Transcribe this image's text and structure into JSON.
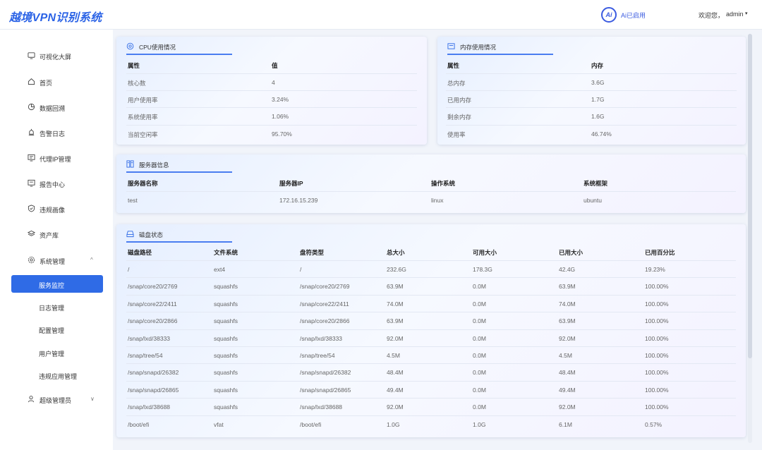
{
  "header": {
    "brand": "越境VPN识别系统",
    "ai_badge": "Ai",
    "ai_status": "Ai已启用",
    "welcome": "欢迎您，",
    "user": "admin",
    "caret": "▾"
  },
  "sidebar": {
    "items": [
      {
        "label": "可视化大屏",
        "icon": "monitor-icon"
      },
      {
        "label": "首页",
        "icon": "home-icon"
      },
      {
        "label": "数据回溯",
        "icon": "pie-chart-icon"
      },
      {
        "label": "告警日志",
        "icon": "alarm-icon"
      },
      {
        "label": "代理IP管理",
        "icon": "proxy-monitor-icon"
      },
      {
        "label": "报告中心",
        "icon": "report-icon"
      },
      {
        "label": "违规画像",
        "icon": "shield-icon"
      },
      {
        "label": "资产库",
        "icon": "layers-icon"
      },
      {
        "label": "系统管理",
        "icon": "settings-icon"
      }
    ],
    "system_arrow": "^",
    "sub_items": [
      {
        "label": "服务监控"
      },
      {
        "label": "日志管理"
      },
      {
        "label": "配置管理"
      },
      {
        "label": "用户管理"
      },
      {
        "label": "违规应用管理"
      }
    ],
    "super_admin": {
      "label": "超级管理员",
      "icon": "user-icon",
      "arrow": "∨"
    }
  },
  "cpu": {
    "title": "CPU使用情况",
    "icon": "cpu-icon",
    "headers": [
      "属性",
      "值"
    ],
    "rows": [
      [
        "核心数",
        "4"
      ],
      [
        "用户使用率",
        "3.24%"
      ],
      [
        "系统使用率",
        "1.06%"
      ],
      [
        "当前空闲率",
        "95.70%"
      ]
    ]
  },
  "memory": {
    "title": "内存使用情况",
    "icon": "memory-icon",
    "headers": [
      "属性",
      "内存"
    ],
    "rows": [
      [
        "总内存",
        "3.6G"
      ],
      [
        "已用内存",
        "1.7G"
      ],
      [
        "剩余内存",
        "1.6G"
      ],
      [
        "使用率",
        "46.74%"
      ]
    ]
  },
  "server": {
    "title": "服务器信息",
    "icon": "server-icon",
    "headers": [
      "服务器名称",
      "服务器IP",
      "操作系统",
      "系统框架"
    ],
    "rows": [
      [
        "test",
        "172.16.15.239",
        "linux",
        "ubuntu"
      ]
    ]
  },
  "disk": {
    "title": "磁盘状态",
    "icon": "disk-icon",
    "headers": [
      "磁盘路径",
      "文件系统",
      "盘符类型",
      "总大小",
      "可用大小",
      "已用大小",
      "已用百分比"
    ],
    "rows": [
      [
        "/",
        "ext4",
        "/",
        "232.6G",
        "178.3G",
        "42.4G",
        "19.23%"
      ],
      [
        "/snap/core20/2769",
        "squashfs",
        "/snap/core20/2769",
        "63.9M",
        "0.0M",
        "63.9M",
        "100.00%"
      ],
      [
        "/snap/core22/2411",
        "squashfs",
        "/snap/core22/2411",
        "74.0M",
        "0.0M",
        "74.0M",
        "100.00%"
      ],
      [
        "/snap/core20/2866",
        "squashfs",
        "/snap/core20/2866",
        "63.9M",
        "0.0M",
        "63.9M",
        "100.00%"
      ],
      [
        "/snap/lxd/38333",
        "squashfs",
        "/snap/lxd/38333",
        "92.0M",
        "0.0M",
        "92.0M",
        "100.00%"
      ],
      [
        "/snap/tree/54",
        "squashfs",
        "/snap/tree/54",
        "4.5M",
        "0.0M",
        "4.5M",
        "100.00%"
      ],
      [
        "/snap/snapd/26382",
        "squashfs",
        "/snap/snapd/26382",
        "48.4M",
        "0.0M",
        "48.4M",
        "100.00%"
      ],
      [
        "/snap/snapd/26865",
        "squashfs",
        "/snap/snapd/26865",
        "49.4M",
        "0.0M",
        "49.4M",
        "100.00%"
      ],
      [
        "/snap/lxd/38688",
        "squashfs",
        "/snap/lxd/38688",
        "92.0M",
        "0.0M",
        "92.0M",
        "100.00%"
      ],
      [
        "/boot/efi",
        "vfat",
        "/boot/efi",
        "1.0G",
        "1.0G",
        "6.1M",
        "0.57%"
      ]
    ]
  },
  "colors": {
    "accent": "#2f6be6",
    "brand": "#2b63e6"
  }
}
